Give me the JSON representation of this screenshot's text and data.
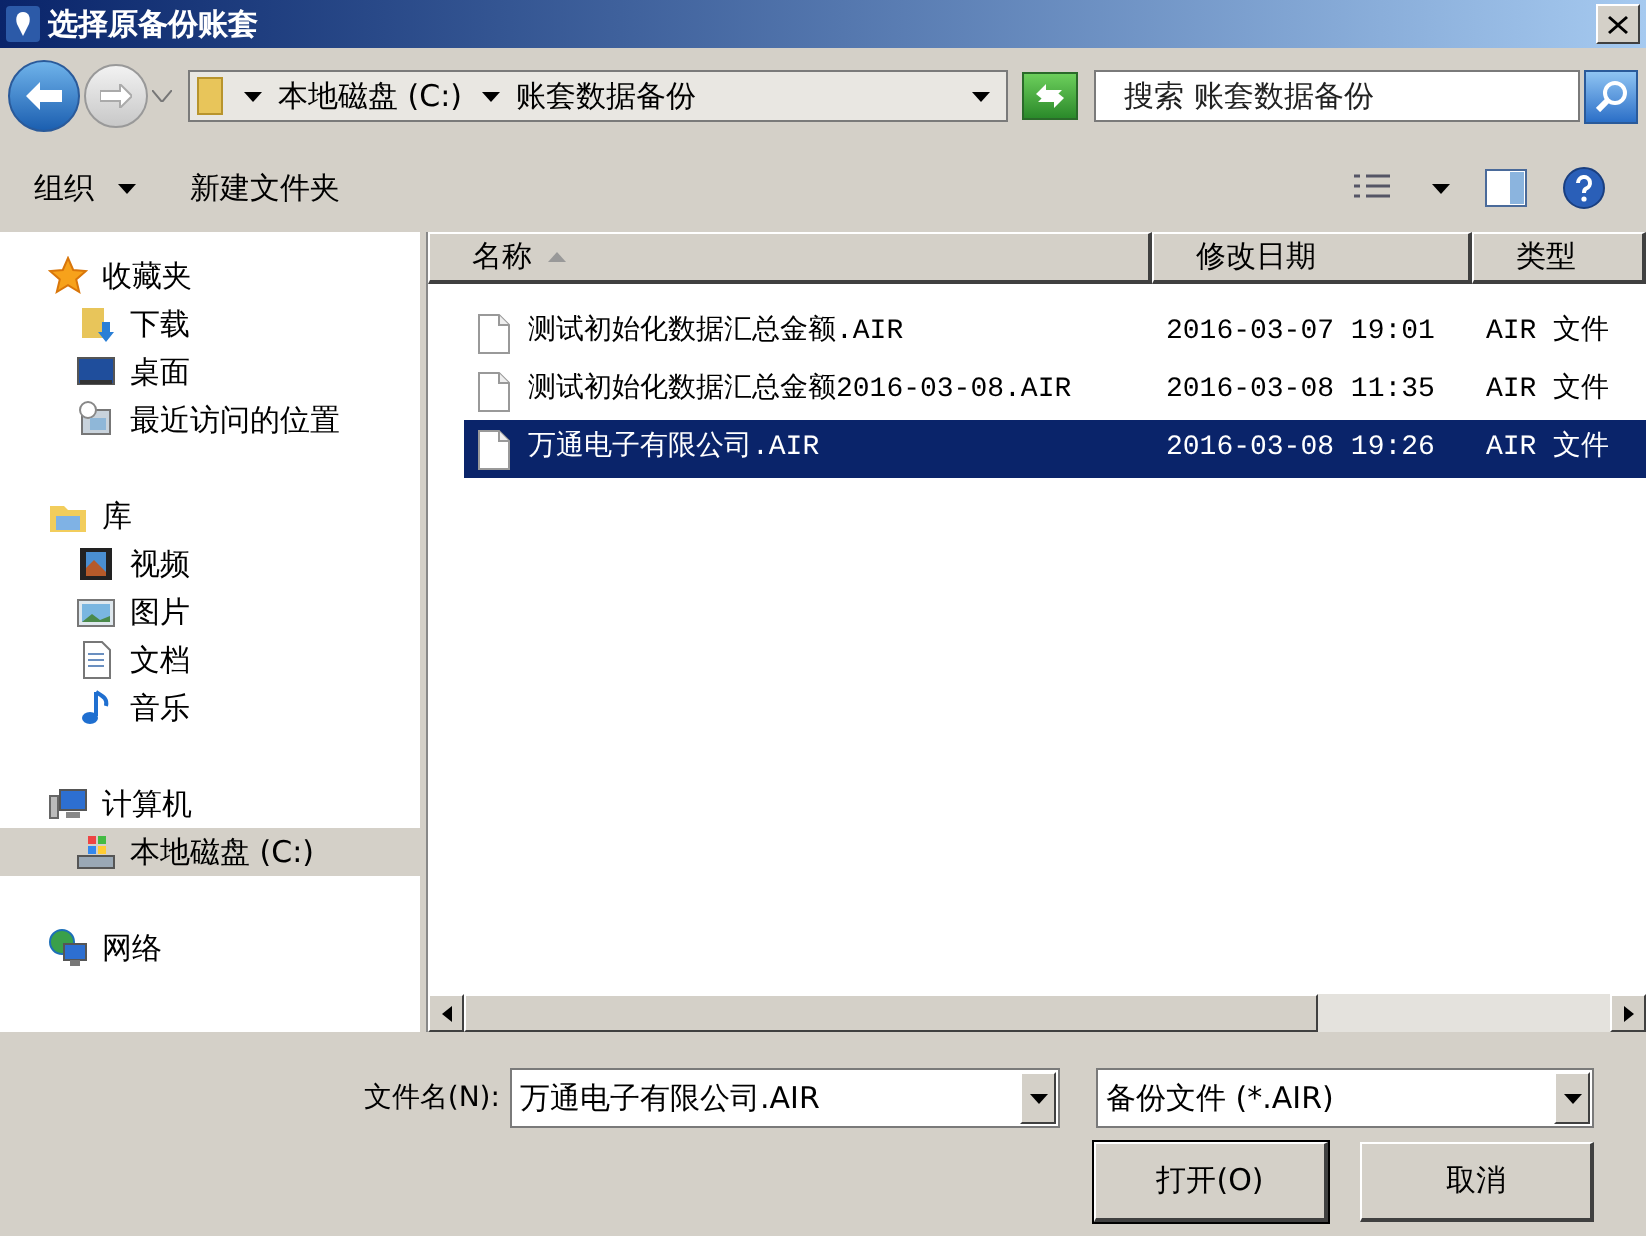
{
  "window": {
    "title": "选择原备份账套"
  },
  "address_bar": {
    "path": [
      {
        "label": "本地磁盘 (C:)"
      },
      {
        "label": "账套数据备份"
      }
    ]
  },
  "search": {
    "placeholder": "搜索 账套数据备份"
  },
  "toolbar": {
    "items": [
      {
        "label": "组织",
        "kind": "menu"
      },
      {
        "label": "新建文件夹",
        "kind": "button"
      }
    ]
  },
  "navigation": [
    {
      "label": "收藏夹",
      "selected": false,
      "children": [
        {
          "label": "下载",
          "selected": false
        },
        {
          "label": "桌面",
          "selected": false
        },
        {
          "label": "最近访问的位置",
          "selected": false
        }
      ]
    },
    {
      "label": "库",
      "selected": false,
      "children": [
        {
          "label": "视频",
          "selected": false
        },
        {
          "label": "图片",
          "selected": false
        },
        {
          "label": "文档",
          "selected": false
        },
        {
          "label": "音乐",
          "selected": false
        }
      ]
    },
    {
      "label": "计算机",
      "selected": false,
      "children": [
        {
          "label": "本地磁盘 (C:)",
          "selected": true
        }
      ]
    },
    {
      "label": "网络",
      "selected": false
    }
  ],
  "table": {
    "columns": [
      {
        "label": "名称",
        "sorted": true
      },
      {
        "label": "修改日期",
        "sorted": false
      },
      {
        "label": "类型",
        "sorted": false
      }
    ],
    "rows": [
      {
        "name": "测试初始化数据汇总金额.AIR",
        "modified": "2016-03-07 19:01",
        "type": "AIR 文件",
        "selected": false
      },
      {
        "name": "测试初始化数据汇总金额2016-03-08.AIR",
        "modified": "2016-03-08 11:35",
        "type": "AIR 文件",
        "selected": false
      },
      {
        "name": "万通电子有限公司.AIR",
        "modified": "2016-03-08 19:26",
        "type": "AIR 文件",
        "selected": true
      }
    ]
  },
  "file_name": {
    "label": "文件名(N):",
    "value": "万通电子有限公司.AIR"
  },
  "file_type": {
    "value": "备份文件 (*.AIR)"
  },
  "buttons": [
    {
      "label": "打开(O)",
      "kind": "default"
    },
    {
      "label": "取消",
      "kind": "normal"
    }
  ]
}
